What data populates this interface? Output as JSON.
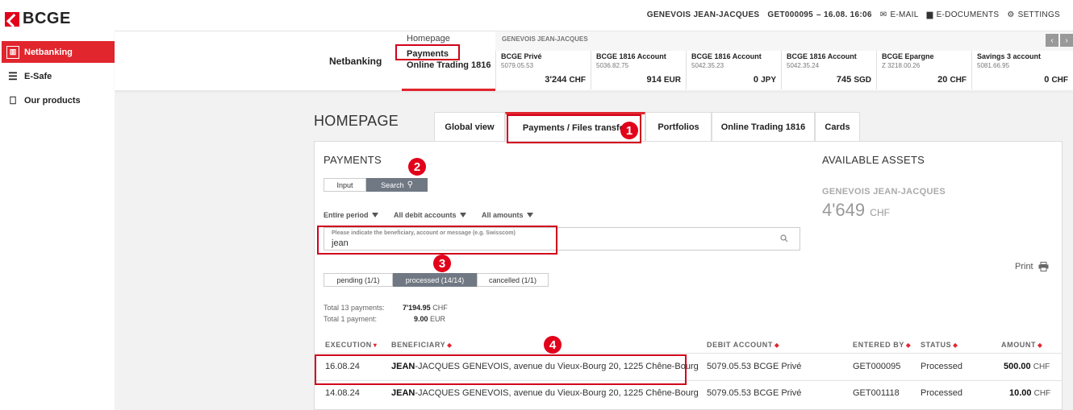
{
  "app": {
    "logo": "BCGE"
  },
  "sidebar": {
    "items": [
      {
        "label": "Netbanking",
        "icon": "bank-icon"
      },
      {
        "label": "E-Safe",
        "icon": "stack-icon"
      },
      {
        "label": "Our products",
        "icon": "bag-icon"
      }
    ]
  },
  "topbar": {
    "user": "GENEVOIS JEAN-JACQUES",
    "contract": "GET000095",
    "datetime": "– 16.08. 16:06",
    "email": "E-MAIL",
    "edocs": "E-DOCUMENTS",
    "settings": "SETTINGS"
  },
  "header": {
    "netbanking": "Netbanking",
    "menu": [
      "Homepage",
      "Payments",
      "Online Trading 1816"
    ],
    "owner": "GENEVOIS JEAN-JACQUES",
    "accounts": [
      {
        "name": "BCGE Privé",
        "number": "5079.05.53",
        "balance": "3'244",
        "currency": "CHF"
      },
      {
        "name": "BCGE 1816 Account",
        "number": "5036.82.75",
        "balance": "914",
        "currency": "EUR"
      },
      {
        "name": "BCGE 1816 Account",
        "number": "5042.35.23",
        "balance": "0",
        "currency": "JPY"
      },
      {
        "name": "BCGE 1816 Account",
        "number": "5042.35.24",
        "balance": "745",
        "currency": "SGD"
      },
      {
        "name": "BCGE Epargne",
        "number": "Z 3218.00.26",
        "balance": "20",
        "currency": "CHF"
      },
      {
        "name": "Savings 3 account",
        "number": "5081.66.95",
        "balance": "0",
        "currency": "CHF"
      }
    ]
  },
  "main": {
    "title": "HOMEPAGE",
    "tabs": [
      "Global view",
      "Payments / Files transfer",
      "Portfolios",
      "Online Trading 1816",
      "Cards"
    ],
    "payments_title": "PAYMENTS",
    "mode": {
      "input": "Input",
      "search": "Search"
    },
    "filters": {
      "period": "Entire period",
      "accounts": "All debit accounts",
      "amounts": "All amounts"
    },
    "search": {
      "placeholder": "Please indicate the beneficiary, account or message (e.g. Swisscom)",
      "value": "jean"
    },
    "status_tabs": {
      "pending": "pending (1/1)",
      "processed": "processed (14/14)",
      "cancelled": "cancelled (1/1)"
    },
    "totals": [
      {
        "label": "Total 13 payments:",
        "amount": "7'194.95",
        "currency": "CHF"
      },
      {
        "label": "Total 1 payment:",
        "amount": "9.00",
        "currency": "EUR"
      }
    ],
    "assets": {
      "title": "AVAILABLE ASSETS",
      "owner": "GENEVOIS JEAN-JACQUES",
      "value": "4'649",
      "currency": "CHF"
    },
    "print": "Print",
    "columns": [
      "EXECUTION",
      "BENEFICIARY",
      "DEBIT ACCOUNT",
      "ENTERED BY",
      "STATUS",
      "AMOUNT"
    ],
    "rows": [
      {
        "execution": "16.08.24",
        "beneficiary_bold": "JEAN",
        "beneficiary_rest": "-JACQUES GENEVOIS, avenue du Vieux-Bourg 20, 1225 Chêne-Bourg",
        "debit": "5079.05.53 BCGE Privé",
        "entered": "GET000095",
        "status": "Processed",
        "amount": "500.00",
        "currency": "CHF"
      },
      {
        "execution": "14.08.24",
        "beneficiary_bold": "JEAN",
        "beneficiary_rest": "-JACQUES GENEVOIS, avenue du Vieux-Bourg 20, 1225 Chêne-Bourg",
        "debit": "5079.05.53 BCGE Privé",
        "entered": "GET001118",
        "status": "Processed",
        "amount": "10.00",
        "currency": "CHF"
      }
    ]
  },
  "annotations": [
    "1",
    "2",
    "3",
    "4"
  ],
  "colors": {
    "accent": "#e1262e",
    "segment_selected": "#707883"
  }
}
